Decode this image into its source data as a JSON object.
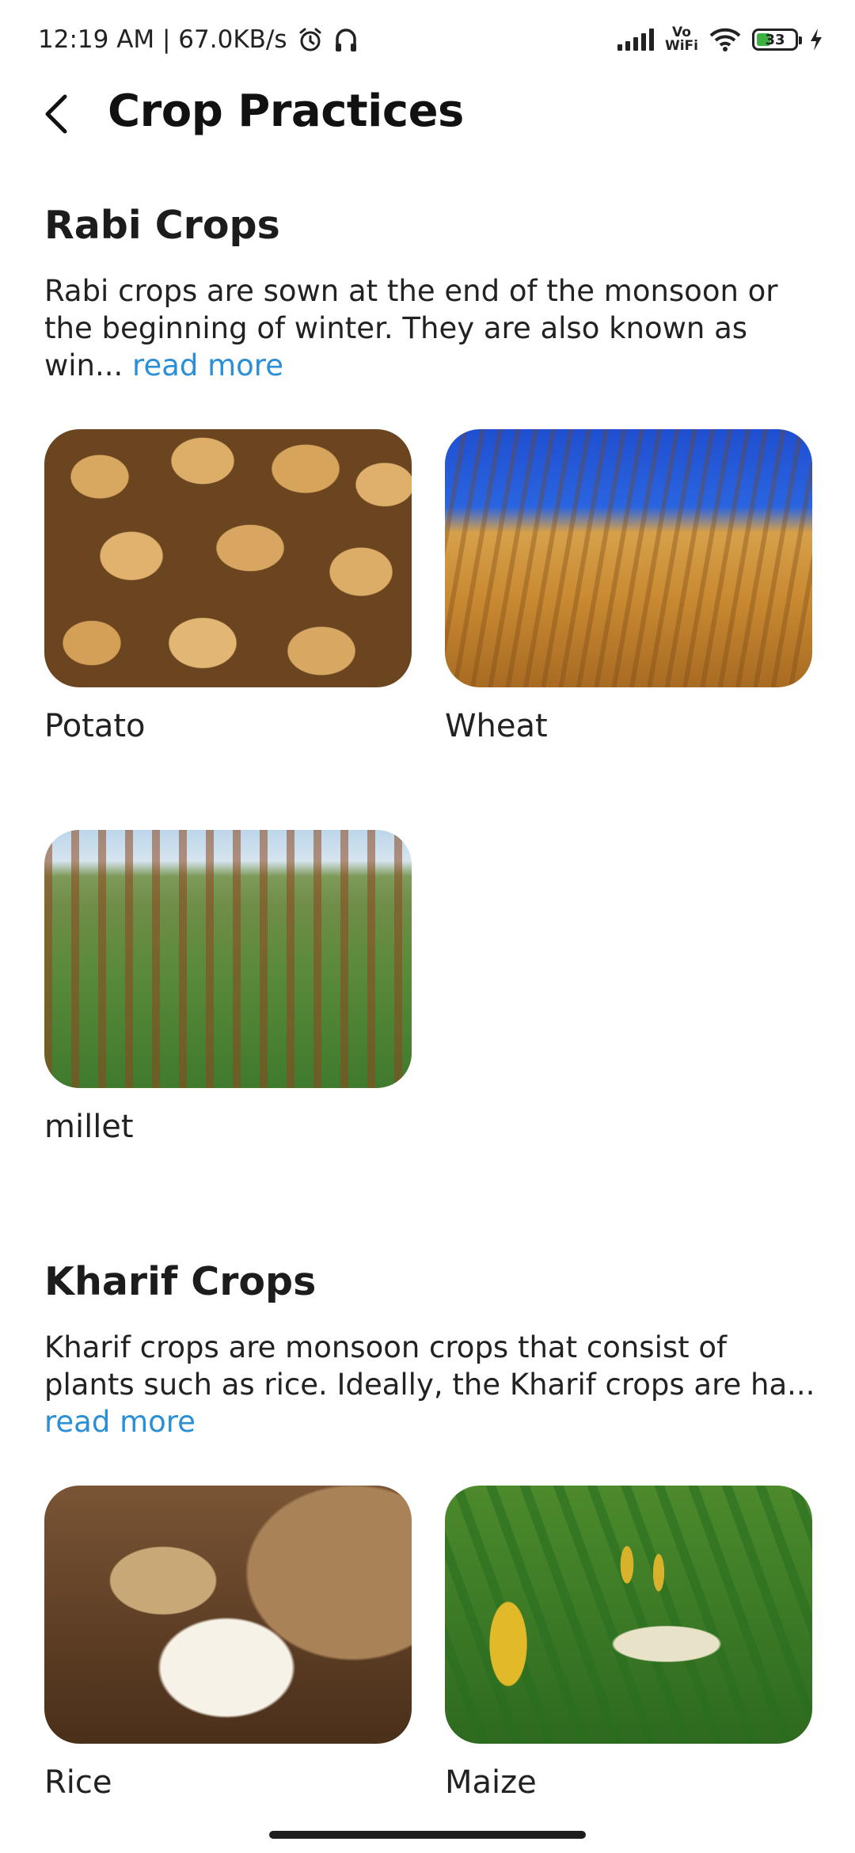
{
  "status_bar": {
    "time_speed": "12:19 AM | 67.0KB/s",
    "vowifi_top": "Vo",
    "vowifi_bottom": "WiFi",
    "battery_level": "33",
    "icons": [
      "alarm-icon",
      "headphones-icon",
      "signal-icon",
      "wifi-icon",
      "battery-icon",
      "charging-icon"
    ]
  },
  "header": {
    "title": "Crop Practices",
    "back_icon": "back-arrow-icon"
  },
  "sections": [
    {
      "title": "Rabi Crops",
      "description": "Rabi crops are sown at the end of the monsoon or the beginning of winter. They are also known as win...",
      "read_more": "read more",
      "crops": [
        {
          "name": "Potato",
          "image": "potatoes-photo"
        },
        {
          "name": "Wheat",
          "image": "wheat-field-photo"
        },
        {
          "name": "millet",
          "image": "millet-field-photo"
        }
      ]
    },
    {
      "title": "Kharif Crops",
      "description": "Kharif crops are monsoon crops that consist of plants such as rice. Ideally, the Kharif crops are ha...",
      "read_more": "read more",
      "crops": [
        {
          "name": "Rice",
          "image": "rice-sack-photo"
        },
        {
          "name": "Maize",
          "image": "maize-plant-photo"
        }
      ]
    }
  ],
  "colors": {
    "link": "#2a8fd6",
    "text": "#1e1e1e",
    "background": "#ffffff"
  }
}
